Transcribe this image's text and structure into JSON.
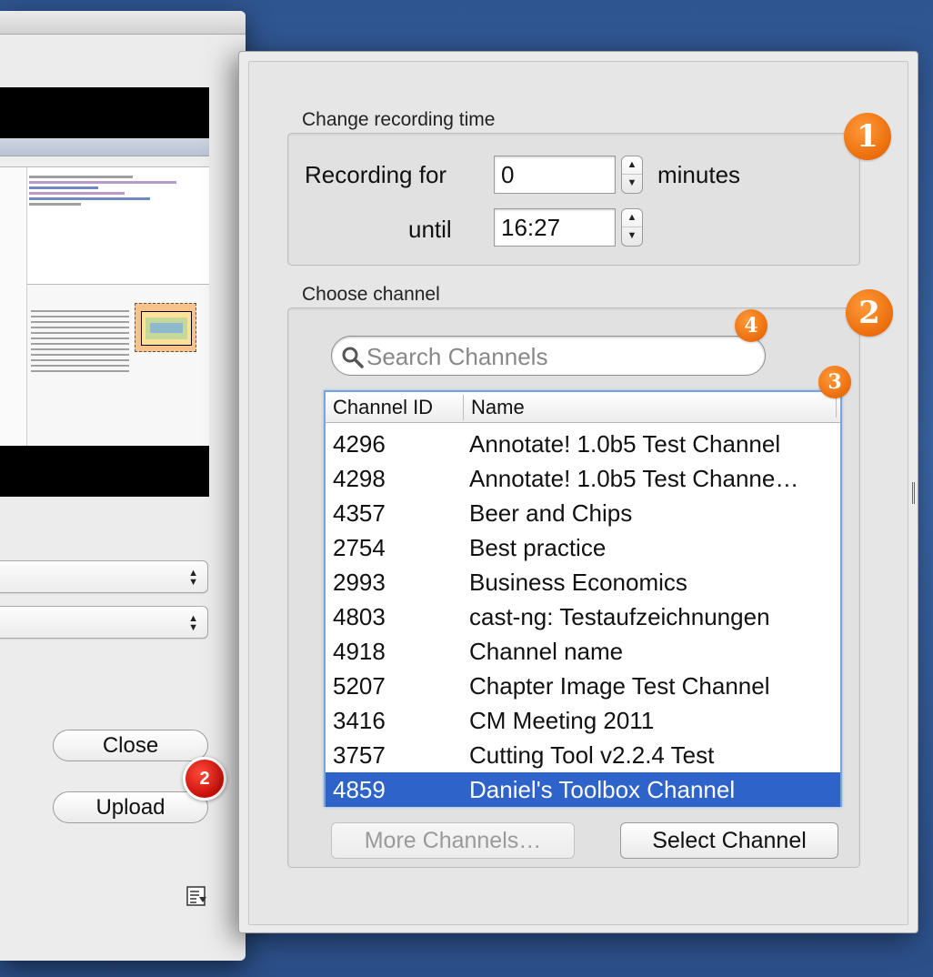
{
  "back_window": {
    "close_label": "Close",
    "upload_label": "Upload",
    "upload_badge": "2"
  },
  "recording": {
    "group_label": "Change recording time",
    "recording_for_label": "Recording for",
    "minutes_value": "0",
    "minutes_label": "minutes",
    "until_label": "until",
    "until_value": "16:27",
    "badge": "1"
  },
  "channel": {
    "group_label": "Choose channel",
    "badge": "2",
    "search_placeholder": "Search Channels",
    "search_badge": "4",
    "table_badge": "3",
    "columns": [
      "Channel ID",
      "Name"
    ],
    "rows": [
      {
        "id": "4296",
        "name": "Annotate! 1.0b5 Test Channel"
      },
      {
        "id": "4298",
        "name": "Annotate! 1.0b5 Test Channe…"
      },
      {
        "id": "4357",
        "name": "Beer and Chips"
      },
      {
        "id": "2754",
        "name": "Best practice"
      },
      {
        "id": "2993",
        "name": "Business Economics"
      },
      {
        "id": "4803",
        "name": "cast-ng: Testaufzeichnungen"
      },
      {
        "id": "4918",
        "name": "Channel name"
      },
      {
        "id": "5207",
        "name": "Chapter Image Test Channel"
      },
      {
        "id": "3416",
        "name": "CM Meeting 2011"
      },
      {
        "id": "3757",
        "name": "Cutting Tool v2.2.4 Test"
      },
      {
        "id": "4859",
        "name": "Daniel's Toolbox Channel"
      }
    ],
    "selected_index": 10,
    "more_button": "More Channels…",
    "select_button": "Select Channel"
  },
  "colors": {
    "badge_orange": "#ea6a08",
    "badge_red": "#c8100a",
    "selection": "#2e63c9",
    "desktop": "#3a64a4"
  }
}
